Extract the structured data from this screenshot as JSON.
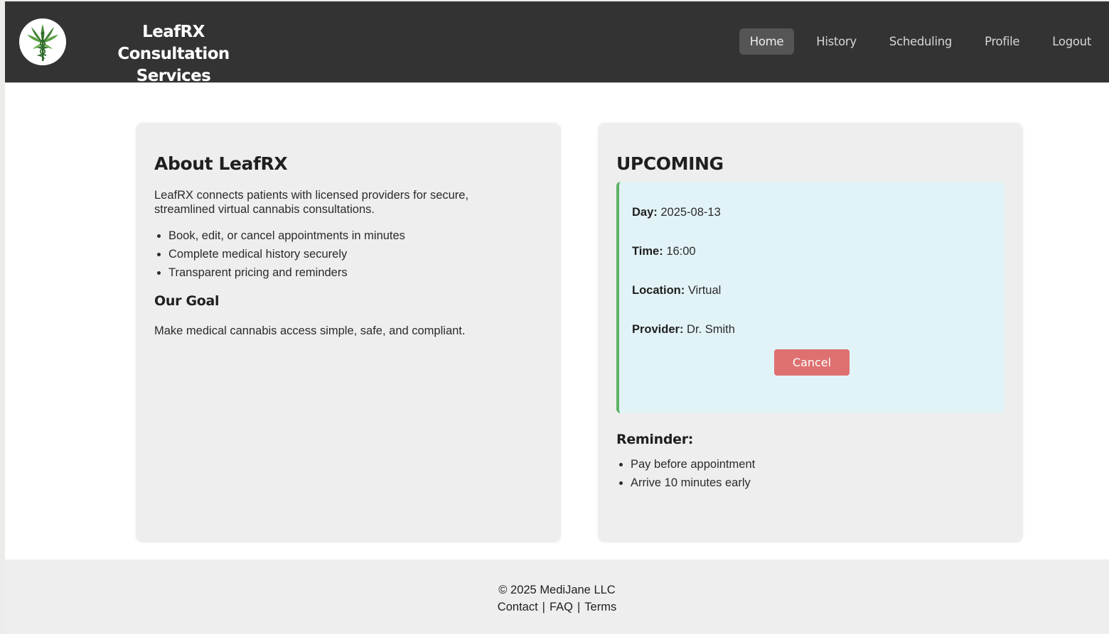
{
  "header": {
    "brand_line1": "LeafRX",
    "brand_line2": "Consultation Services",
    "logo_icon": "caduceus-leaf-icon",
    "nav": [
      {
        "label": "Home",
        "active": true
      },
      {
        "label": "History",
        "active": false
      },
      {
        "label": "Scheduling",
        "active": false
      },
      {
        "label": "Profile",
        "active": false
      },
      {
        "label": "Logout",
        "active": false
      }
    ]
  },
  "about": {
    "title": "About LeafRX",
    "description": "LeafRX connects patients with licensed providers for secure, streamlined virtual cannabis consultations.",
    "features": [
      "Book, edit, or cancel appointments in minutes",
      "Complete medical history securely",
      "Transparent pricing and reminders"
    ],
    "goal_title": "Our Goal",
    "goal_text": "Make medical cannabis access simple, safe, and compliant."
  },
  "upcoming": {
    "title": "UPCOMING",
    "appointment": {
      "day_label": "Day:",
      "day_value": "2025-08-13",
      "time_label": "Time:",
      "time_value": "16:00",
      "location_label": "Location:",
      "location_value": "Virtual",
      "provider_label": "Provider:",
      "provider_value": "Dr. Smith"
    },
    "cancel_label": "Cancel",
    "reminder_title": "Reminder:",
    "reminders": [
      "Pay before appointment",
      "Arrive 10 minutes early"
    ]
  },
  "footer": {
    "copyright": "© 2025 MediJane LLC",
    "links": [
      "Contact",
      "FAQ",
      "Terms"
    ],
    "separator": "|"
  },
  "colors": {
    "header_bg": "#333333",
    "card_bg": "#eeeeee",
    "appt_bg": "#e2f3f8",
    "appt_accent": "#5db364",
    "cancel_bg": "#de7070"
  }
}
